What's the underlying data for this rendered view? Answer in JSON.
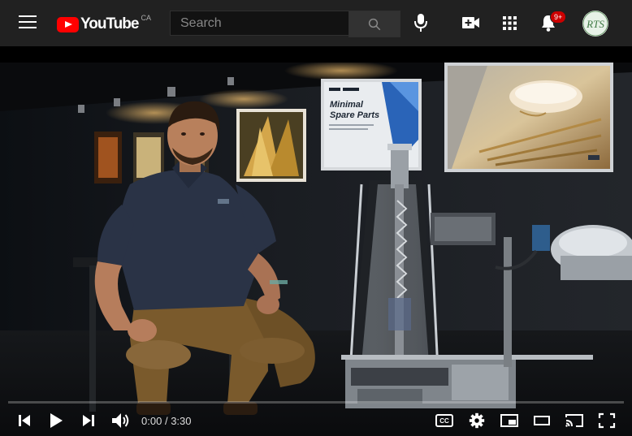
{
  "masthead": {
    "logo_text": "YouTube",
    "region": "CA",
    "search": {
      "placeholder": "Search",
      "value": ""
    },
    "notifications_badge": "9+",
    "avatar_initials": "RTS"
  },
  "player": {
    "progress": 0.0,
    "time_current": "0:00",
    "time_separator": "/",
    "time_duration": "3:30",
    "captions_label": "CC",
    "poster_heading_line1": "Minimal",
    "poster_heading_line2": "Spare Parts"
  },
  "colors": {
    "brand_red": "#ff0000",
    "badge_red": "#cc0000",
    "masthead_bg": "#212121",
    "shirt_navy": "#2a3346",
    "pants_khaki": "#7a5a2c"
  },
  "icons": [
    "menu-icon",
    "youtube-logo-icon",
    "search-icon",
    "mic-icon",
    "create-video-icon",
    "apps-grid-icon",
    "bell-icon",
    "prev-icon",
    "play-icon",
    "next-icon",
    "volume-icon",
    "cc-icon",
    "settings-gear-icon",
    "miniplayer-icon",
    "theater-mode-icon",
    "cast-icon",
    "fullscreen-icon"
  ]
}
